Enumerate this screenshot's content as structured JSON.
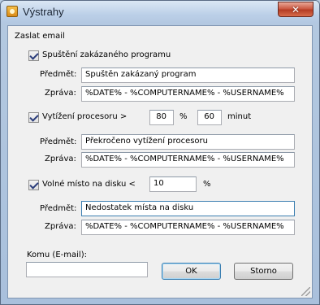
{
  "window": {
    "title": "Výstrahy",
    "close_label": "✕"
  },
  "form": {
    "section_label": "Zaslat email",
    "blocked_program": {
      "checkbox_label": "Spuštění zakázaného programu",
      "checked": true,
      "subject_label": "Předmět:",
      "subject_value": "Spuštěn zakázaný program",
      "message_label": "Zpráva:",
      "message_value": "%DATE% - %COMPUTERNAME% - %USERNAME%"
    },
    "cpu_load": {
      "checkbox_label": "Vytížení procesoru >",
      "checked": true,
      "percent_value": "80",
      "percent_unit": "%",
      "minutes_value": "60",
      "minutes_unit": "minut",
      "subject_label": "Předmět:",
      "subject_value": "Překročeno vytížení procesoru",
      "message_label": "Zpráva:",
      "message_value": "%DATE% - %COMPUTERNAME% - %USERNAME%"
    },
    "disk_space": {
      "checkbox_label": "Volné místo na disku <",
      "checked": true,
      "percent_value": "10",
      "percent_unit": "%",
      "subject_label": "Předmět:",
      "subject_value": "Nedostatek místa na disku",
      "message_label": "Zpráva:",
      "message_value": "%DATE% - %COMPUTERNAME% - %USERNAME%"
    },
    "email_label": "Komu (E-mail):",
    "email_value": "",
    "ok_label": "OK",
    "cancel_label": "Storno"
  }
}
